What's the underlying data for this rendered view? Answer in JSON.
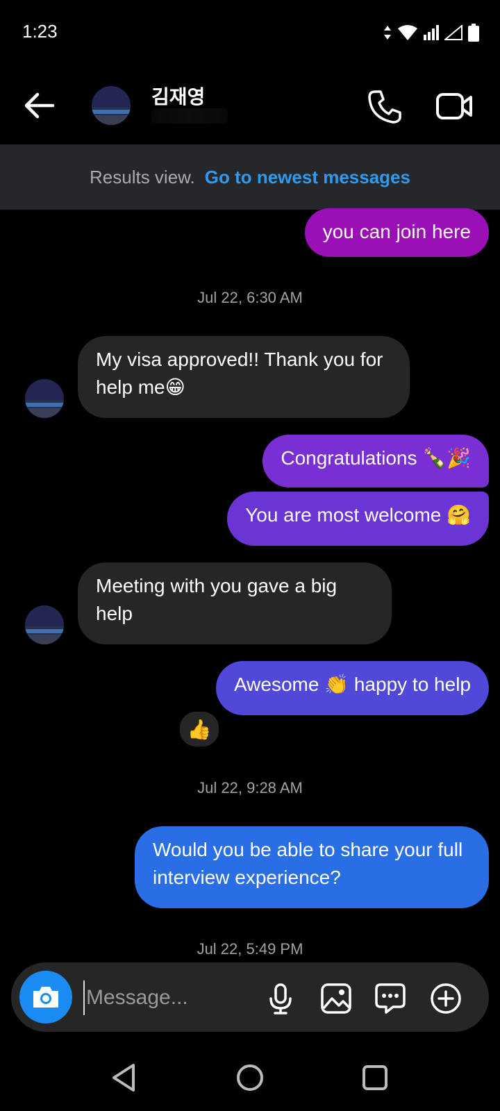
{
  "status_bar": {
    "time": "1:23"
  },
  "header": {
    "contact_name": "김재영"
  },
  "banner": {
    "text": "Results view.",
    "link": "Go to newest messages"
  },
  "messages": [
    {
      "dir": "out",
      "text": "you can join here",
      "color": "#9a0fb6"
    },
    {
      "dir": "timestamp",
      "text": "Jul 22, 6:30 AM"
    },
    {
      "dir": "in",
      "text": "My visa approved!! Thank you for help me😁"
    },
    {
      "dir": "out",
      "text": "Congratulations 🍾🎉",
      "color": "#7a2fd4"
    },
    {
      "dir": "out",
      "text": "You are most welcome 🤗",
      "color": "#6b35d6"
    },
    {
      "dir": "in",
      "text": "Meeting with you gave a big help"
    },
    {
      "dir": "out",
      "text": "Awesome 👏 happy to help",
      "color": "#5048d9"
    },
    {
      "dir": "timestamp",
      "text": "Jul 22, 9:28 AM"
    },
    {
      "dir": "out",
      "text": "Would you be able to share your full interview experience?",
      "color": "#2a6ee6"
    },
    {
      "dir": "timestamp",
      "text": "Jul 22, 5:49 PM"
    }
  ],
  "reaction": {
    "emoji": "👍"
  },
  "composer": {
    "placeholder": "Message..."
  },
  "icons": {
    "back": "arrow-left-icon",
    "call": "phone-icon",
    "video": "video-camera-icon",
    "camera": "camera-icon",
    "mic": "microphone-icon",
    "gallery": "image-icon",
    "sticker": "chat-bubble-icon",
    "plus": "plus-circle-icon",
    "nav_back": "triangle-back-icon",
    "nav_home": "circle-home-icon",
    "nav_recents": "square-recents-icon"
  },
  "colors": {
    "accent": "#1a8cf3",
    "link": "#2e9bf0",
    "incoming_bubble": "#262626",
    "banner_bg": "#26272b"
  }
}
